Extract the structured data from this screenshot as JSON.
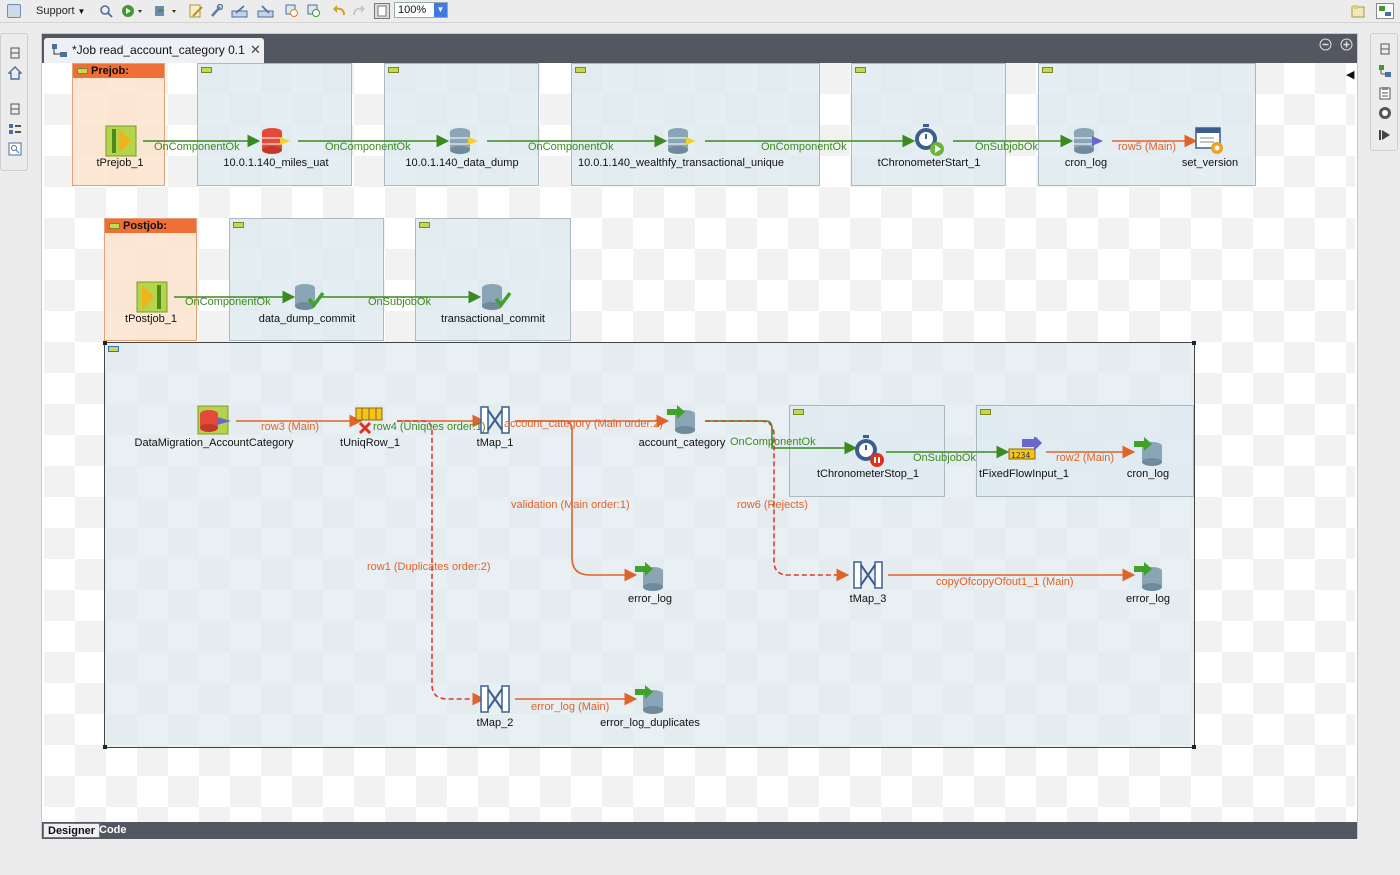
{
  "toolbar": {
    "support_label": "Support",
    "zoom_value": "100%"
  },
  "editor": {
    "tab_title": "*Job read_account_category 0.1",
    "bottom_tabs": [
      "Designer",
      "Code"
    ]
  },
  "subjobs": {
    "prejob_header": "Prejob:",
    "postjob_header": "Postjob:"
  },
  "components": {
    "tPrejob_1": "tPrejob_1",
    "miles_uat": "10.0.1.140_miles_uat",
    "data_dump": "10.0.1.140_data_dump",
    "wealthfy": "10.0.1.140_wealthfy_transactional_unique",
    "tChronometerStart_1": "tChronometerStart_1",
    "cron_log_top": "cron_log",
    "set_version": "set_version",
    "tPostjob_1": "tPostjob_1",
    "data_dump_commit": "data_dump_commit",
    "transactional_commit": "transactional_commit",
    "DataMigration_AccountCategory": "DataMigration_AccountCategory",
    "tUniqRow_1": "tUniqRow_1",
    "tMap_1": "tMap_1",
    "account_category": "account_category",
    "tChronometerStop_1": "tChronometerStop_1",
    "tFixedFlowInput_1": "tFixedFlowInput_1",
    "cron_log_main": "cron_log",
    "error_log_1": "error_log",
    "tMap_3": "tMap_3",
    "error_log_2": "error_log",
    "tMap_2": "tMap_2",
    "error_log_duplicates": "error_log_duplicates"
  },
  "links": {
    "l1": "OnComponentOk",
    "l2": "OnComponentOk",
    "l3": "OnComponentOk",
    "l4": "OnComponentOk",
    "l5": "OnSubjobOk",
    "l6": "row5 (Main)",
    "l7": "OnComponentOk",
    "l8": "OnSubjobOk",
    "l9": "row3 (Main)",
    "l10": "row4 (Uniques order:1)",
    "l11": "account_category (Main order:2)",
    "l12": "OnComponentOk",
    "l13": "OnSubjobOk",
    "l14": "row2 (Main)",
    "l15": "validation (Main order:1)",
    "l16": "row6 (Rejects)",
    "l17": "copyOfcopyOfout1_1 (Main)",
    "l18": "row1 (Duplicates order:2)",
    "l19": "error_log (Main)"
  },
  "colors": {
    "trigger": "#3c8a1f",
    "row": "#e0632a",
    "subjob_fill": "#deeaf0",
    "prejob_header": "#ef6f37",
    "tab_bar": "#525761"
  }
}
